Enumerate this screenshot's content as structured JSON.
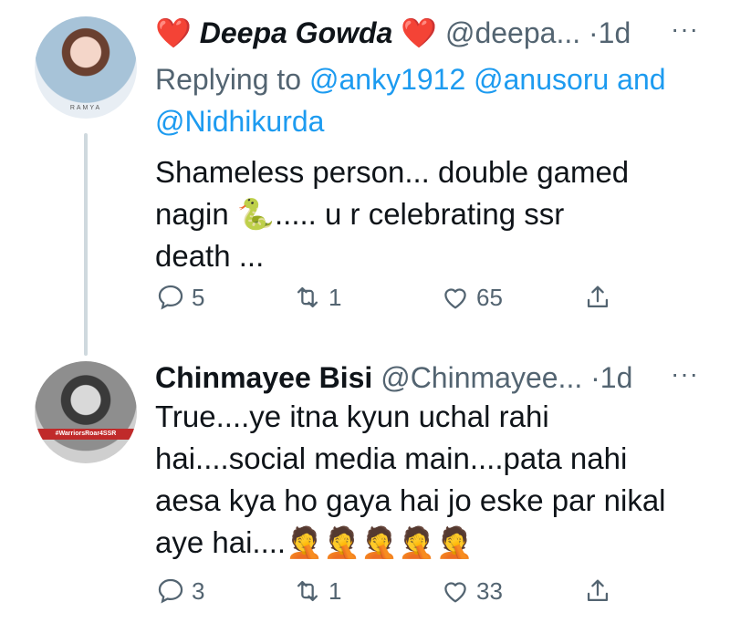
{
  "tweets": [
    {
      "avatar_caption": "RAMYA",
      "name": "Deepa Gowda",
      "name_prefix": "❤️",
      "name_suffix": "❤️",
      "handle": "@deepa...",
      "dot": "·",
      "time": "1d",
      "more": "···",
      "replying_label": "Replying to",
      "replying_to": [
        "@anky1912",
        "@anusoru",
        "@Nidhikurda"
      ],
      "replying_and": "and",
      "text_lines": [
        "Shameless person... double gamed",
        "nagin 🐍..... u r celebrating ssr",
        "death ..."
      ],
      "replies": "5",
      "retweets": "1",
      "likes": "65"
    },
    {
      "avatar_band": "#WarriorsRoar4SSR",
      "name": "Chinmayee Bisi",
      "handle": "@Chinmayee...",
      "dot": "·",
      "time": "1d",
      "more": "···",
      "text_lines": [
        "True....ye itna kyun uchal rahi",
        "hai....social media main....pata nahi",
        "aesa kya ho gaya hai jo eske par nikal",
        "aye hai....🤦🤦🤦🤦🤦"
      ],
      "replies": "3",
      "retweets": "1",
      "likes": "33"
    }
  ],
  "icons": [
    "reply-icon",
    "retweet-icon",
    "like-icon",
    "share-icon"
  ],
  "colors": {
    "link": "#1d9bf0",
    "secondary": "#536471",
    "text": "#0f1419",
    "thread_line": "#cfd9de"
  }
}
